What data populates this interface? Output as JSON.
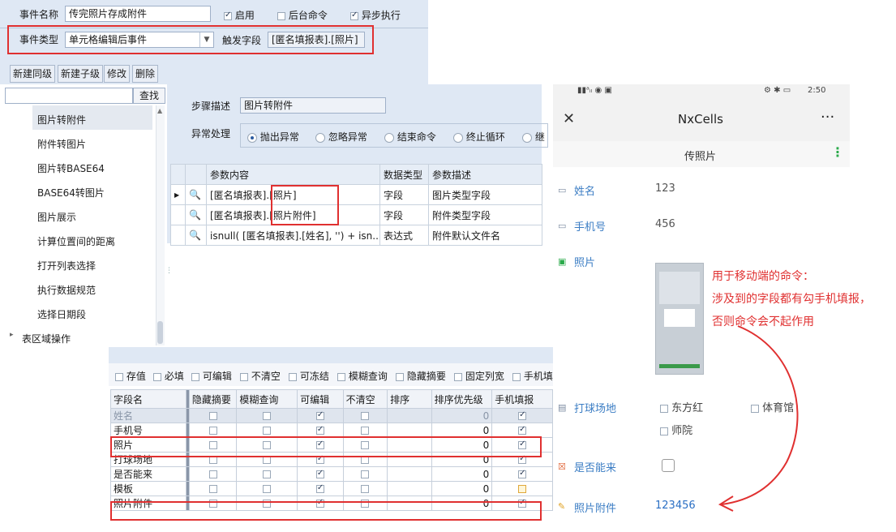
{
  "event_panel": {
    "name_label": "事件名称",
    "name_value": "传完照片存成附件",
    "enable_label": "启用",
    "background_label": "后台命令",
    "async_label": "异步执行",
    "type_label": "事件类型",
    "type_value": "单元格编辑后事件",
    "trigger_label": "触发字段",
    "trigger_value": "[匿名填报表].[照片]",
    "toolbar": {
      "new_sibling": "新建同级",
      "new_child": "新建子级",
      "edit": "修改",
      "delete": "删除"
    }
  },
  "tree": {
    "search_button": "查找",
    "items": [
      "图片转附件",
      "附件转图片",
      "图片转BASE64",
      "BASE64转图片",
      "图片展示",
      "计算位置间的距离",
      "打开列表选择",
      "执行数据规范",
      "选择日期段"
    ],
    "group": "表区域操作"
  },
  "step": {
    "desc_label": "步骤描述",
    "desc_value": "图片转附件",
    "error_label": "异常处理",
    "options": [
      "抛出异常",
      "忽略异常",
      "结束命令",
      "终止循环",
      "继"
    ],
    "table_headers": [
      "参数内容",
      "数据类型",
      "参数描述"
    ],
    "rows": [
      {
        "content_prefix": "[匿名填报表].",
        "content_field": "[照片]",
        "type": "字段",
        "desc": "图片类型字段"
      },
      {
        "content_prefix": "[匿名填报表].",
        "content_field": "[照片附件]",
        "type": "字段",
        "desc": "附件类型字段"
      },
      {
        "content_prefix": "isnull( [匿名填报表].[姓名], '') + isn...",
        "content_field": "",
        "type": "表达式",
        "desc": "附件默认文件名"
      }
    ]
  },
  "fields": {
    "options": [
      "存值",
      "必填",
      "可编辑",
      "不清空",
      "可冻结",
      "模糊查询",
      "隐藏摘要",
      "固定列宽",
      "手机填"
    ],
    "headers": [
      "字段名",
      "隐藏摘要",
      "模糊查询",
      "可编辑",
      "不清空",
      "排序",
      "排序优先级",
      "手机填报"
    ],
    "rows": [
      {
        "name": "姓名",
        "priority": "0"
      },
      {
        "name": "手机号",
        "priority": "0"
      },
      {
        "name": "照片",
        "priority": "0"
      },
      {
        "name": "打球场地",
        "priority": "0"
      },
      {
        "name": "是否能来",
        "priority": "0"
      },
      {
        "name": "模板",
        "priority": "0"
      },
      {
        "name": "照片附件",
        "priority": "0"
      }
    ]
  },
  "phone": {
    "status_time": "2:50",
    "app_title": "NxCells",
    "page_title": "传照片",
    "fields": [
      {
        "label": "姓名",
        "value": "123"
      },
      {
        "label": "手机号",
        "value": "456"
      },
      {
        "label": "照片",
        "value": ""
      },
      {
        "label": "打球场地",
        "value": ""
      },
      {
        "label": "是否能来",
        "value": ""
      },
      {
        "label": "照片附件",
        "value": "123456"
      }
    ],
    "venue_options": [
      "东方红",
      "体育馆",
      "师院"
    ]
  },
  "annotation": {
    "line1": "用于移动端的命令：",
    "line2": "涉及到的字段都有勾手机填报，",
    "line3": "否则命令会不起作用"
  },
  "colors": {
    "accent_red": "#e03030",
    "panel_blue": "#dfe8f4",
    "label_blue": "#3b7dc4"
  }
}
